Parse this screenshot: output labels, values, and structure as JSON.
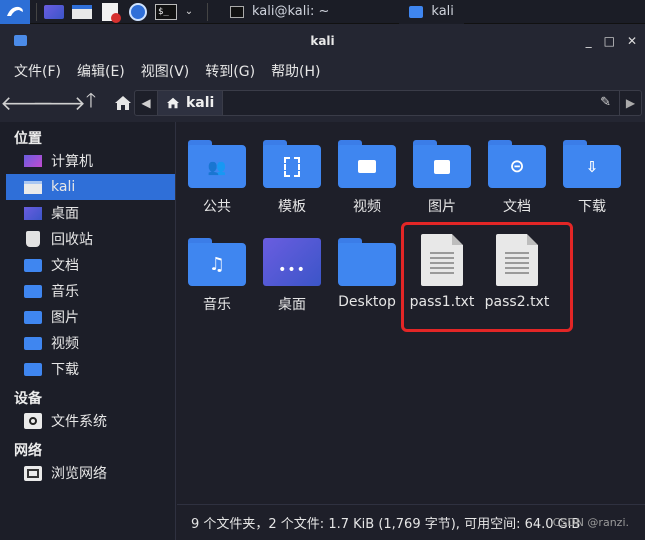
{
  "taskbar": {
    "tasks": [
      {
        "label": "kali@kali: ~",
        "icon": "terminal-icon"
      },
      {
        "label": "kali",
        "icon": "folder-icon"
      }
    ]
  },
  "window": {
    "title": "kali",
    "controls": [
      "_",
      "□",
      "✕"
    ]
  },
  "menu": [
    "文件(F)",
    "编辑(E)",
    "视图(V)",
    "转到(G)",
    "帮助(H)"
  ],
  "path": {
    "current": "kali"
  },
  "sidebar": {
    "sections": [
      {
        "title": "位置",
        "items": [
          {
            "label": "计算机",
            "icon": "computer-icon"
          },
          {
            "label": "kali",
            "icon": "home-folder-icon",
            "selected": true
          },
          {
            "label": "桌面",
            "icon": "desktop-icon"
          },
          {
            "label": "回收站",
            "icon": "trash-icon"
          },
          {
            "label": "文档",
            "icon": "documents-icon"
          },
          {
            "label": "音乐",
            "icon": "music-icon"
          },
          {
            "label": "图片",
            "icon": "pictures-icon"
          },
          {
            "label": "视频",
            "icon": "videos-icon"
          },
          {
            "label": "下载",
            "icon": "downloads-icon"
          }
        ]
      },
      {
        "title": "设备",
        "items": [
          {
            "label": "文件系统",
            "icon": "drive-icon"
          }
        ]
      },
      {
        "title": "网络",
        "items": [
          {
            "label": "浏览网络",
            "icon": "network-icon"
          }
        ]
      }
    ]
  },
  "files": [
    {
      "label": "公共",
      "type": "folder",
      "emblem": "people"
    },
    {
      "label": "模板",
      "type": "folder",
      "emblem": "template"
    },
    {
      "label": "视频",
      "type": "folder",
      "emblem": "video"
    },
    {
      "label": "图片",
      "type": "folder",
      "emblem": "image"
    },
    {
      "label": "文档",
      "type": "folder",
      "emblem": "link"
    },
    {
      "label": "下载",
      "type": "folder",
      "emblem": "download"
    },
    {
      "label": "音乐",
      "type": "folder",
      "emblem": "music"
    },
    {
      "label": "桌面",
      "type": "desktop"
    },
    {
      "label": "Desktop",
      "type": "folder",
      "emblem": "none"
    },
    {
      "label": "pass1.txt",
      "type": "text"
    },
    {
      "label": "pass2.txt",
      "type": "text"
    }
  ],
  "status": "9 个文件夹，2 个文件: 1.7 KiB (1,769 字节), 可用空间: 64.0 GiB",
  "watermark": "CSDN @ranzi.",
  "colors": {
    "accent": "#2f6fd8",
    "folder": "#3f86f0",
    "highlight": "#e32626"
  }
}
